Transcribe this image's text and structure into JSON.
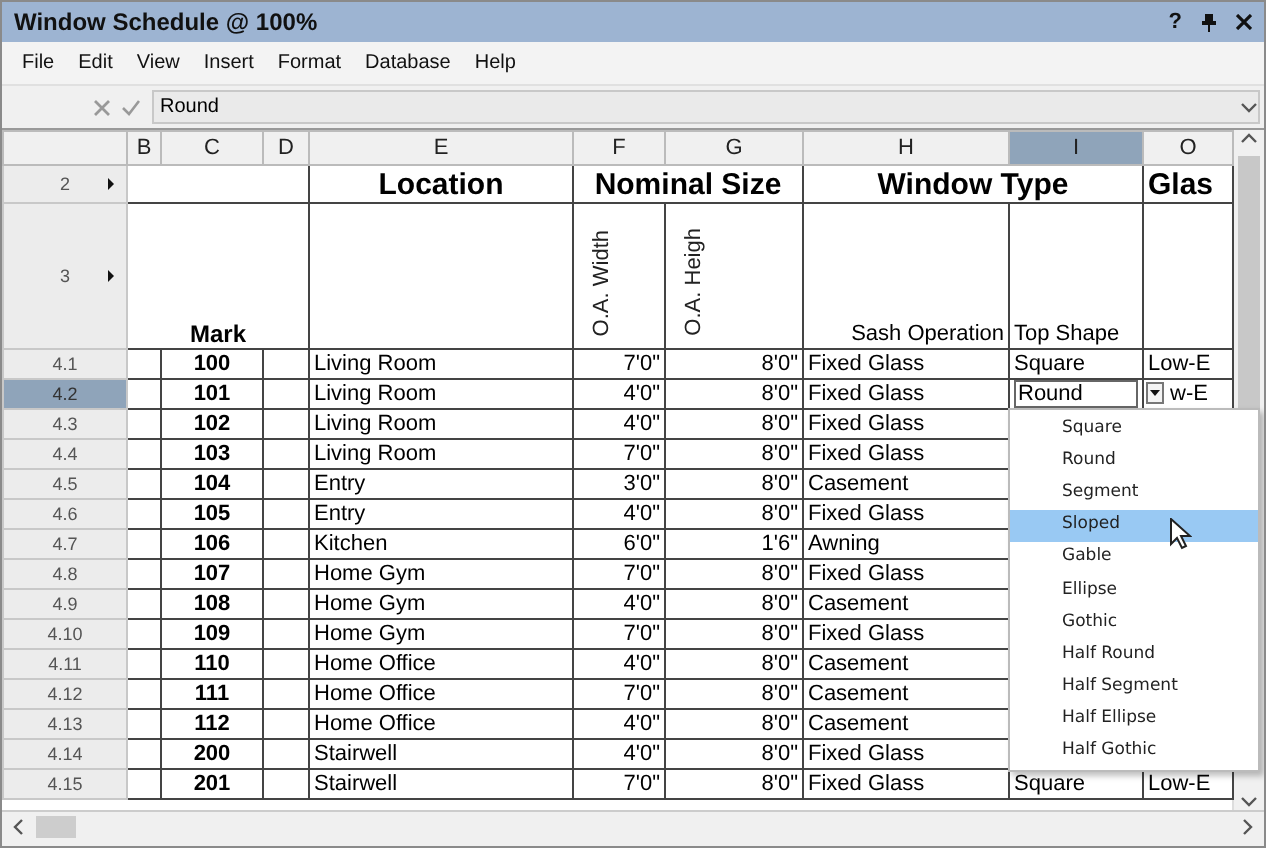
{
  "window": {
    "title": "Window Schedule @ 100%",
    "help_button": "?"
  },
  "menu": [
    "File",
    "Edit",
    "View",
    "Insert",
    "Format",
    "Database",
    "Help"
  ],
  "formula_bar": {
    "value": "Round"
  },
  "columns": [
    {
      "label": "B",
      "selected": false
    },
    {
      "label": "C",
      "selected": false
    },
    {
      "label": "D",
      "selected": false
    },
    {
      "label": "E",
      "selected": false
    },
    {
      "label": "F",
      "selected": false
    },
    {
      "label": "G",
      "selected": false
    },
    {
      "label": "H",
      "selected": false
    },
    {
      "label": "I",
      "selected": true
    },
    {
      "label": "O",
      "selected": false
    }
  ],
  "title_row": {
    "row_label": "2",
    "location": "Location",
    "nominal_size": "Nominal Size",
    "window_type": "Window Type",
    "glazing": "Glas"
  },
  "subtitle_row": {
    "row_label": "3",
    "mark": "Mark",
    "width": "O.A. Width",
    "height": "O.A. Heigh",
    "sash": "Sash Operation",
    "top_shape": "Top Shape"
  },
  "rows": [
    {
      "label": "4.1",
      "selected": false,
      "editing": false,
      "mark": "100",
      "location": "Living Room",
      "width": "7'0\"",
      "height": "8'0\"",
      "sash": "Fixed Glass",
      "top_shape": "Square",
      "glazing": "Low-E"
    },
    {
      "label": "4.2",
      "selected": true,
      "editing": true,
      "mark": "101",
      "location": "Living Room",
      "width": "4'0\"",
      "height": "8'0\"",
      "sash": "Fixed Glass",
      "top_shape": "Round",
      "glazing": "w-E"
    },
    {
      "label": "4.3",
      "selected": false,
      "editing": false,
      "mark": "102",
      "location": "Living Room",
      "width": "4'0\"",
      "height": "8'0\"",
      "sash": "Fixed Glass"
    },
    {
      "label": "4.4",
      "selected": false,
      "editing": false,
      "mark": "103",
      "location": "Living Room",
      "width": "7'0\"",
      "height": "8'0\"",
      "sash": "Fixed Glass"
    },
    {
      "label": "4.5",
      "selected": false,
      "editing": false,
      "mark": "104",
      "location": "Entry",
      "width": "3'0\"",
      "height": "8'0\"",
      "sash": "Casement"
    },
    {
      "label": "4.6",
      "selected": false,
      "editing": false,
      "mark": "105",
      "location": "Entry",
      "width": "4'0\"",
      "height": "8'0\"",
      "sash": "Fixed Glass"
    },
    {
      "label": "4.7",
      "selected": false,
      "editing": false,
      "mark": "106",
      "location": "Kitchen",
      "width": "6'0\"",
      "height": "1'6\"",
      "sash": "Awning"
    },
    {
      "label": "4.8",
      "selected": false,
      "editing": false,
      "mark": "107",
      "location": "Home Gym",
      "width": "7'0\"",
      "height": "8'0\"",
      "sash": "Fixed Glass"
    },
    {
      "label": "4.9",
      "selected": false,
      "editing": false,
      "mark": "108",
      "location": "Home Gym",
      "width": "4'0\"",
      "height": "8'0\"",
      "sash": "Casement"
    },
    {
      "label": "4.10",
      "selected": false,
      "editing": false,
      "mark": "109",
      "location": "Home Gym",
      "width": "7'0\"",
      "height": "8'0\"",
      "sash": "Fixed Glass"
    },
    {
      "label": "4.11",
      "selected": false,
      "editing": false,
      "mark": "110",
      "location": "Home Office",
      "width": "4'0\"",
      "height": "8'0\"",
      "sash": "Casement"
    },
    {
      "label": "4.12",
      "selected": false,
      "editing": false,
      "mark": "111",
      "location": "Home Office",
      "width": "7'0\"",
      "height": "8'0\"",
      "sash": "Casement"
    },
    {
      "label": "4.13",
      "selected": false,
      "editing": false,
      "mark": "112",
      "location": "Home Office",
      "width": "4'0\"",
      "height": "8'0\"",
      "sash": "Casement"
    },
    {
      "label": "4.14",
      "selected": false,
      "editing": false,
      "mark": "200",
      "location": "Stairwell",
      "width": "4'0\"",
      "height": "8'0\"",
      "sash": "Fixed Glass"
    },
    {
      "label": "4.15",
      "selected": false,
      "editing": false,
      "mark": "201",
      "location": "Stairwell",
      "width": "7'0\"",
      "height": "8'0\"",
      "sash": "Fixed Glass",
      "top_shape": "Square",
      "glazing": "Low-E"
    }
  ],
  "dropdown": {
    "items": [
      {
        "label": "Square",
        "selected": false
      },
      {
        "label": "Round",
        "selected": false
      },
      {
        "label": "Segment",
        "selected": false
      },
      {
        "label": "Sloped",
        "selected": true
      },
      {
        "label": "Gable",
        "selected": false
      },
      {
        "label": "Ellipse",
        "selected": false
      },
      {
        "label": "Gothic",
        "selected": false
      },
      {
        "label": "Half Round",
        "selected": false
      },
      {
        "label": "Half Segment",
        "selected": false
      },
      {
        "label": "Half Ellipse",
        "selected": false
      },
      {
        "label": "Half Gothic",
        "selected": false
      }
    ]
  }
}
